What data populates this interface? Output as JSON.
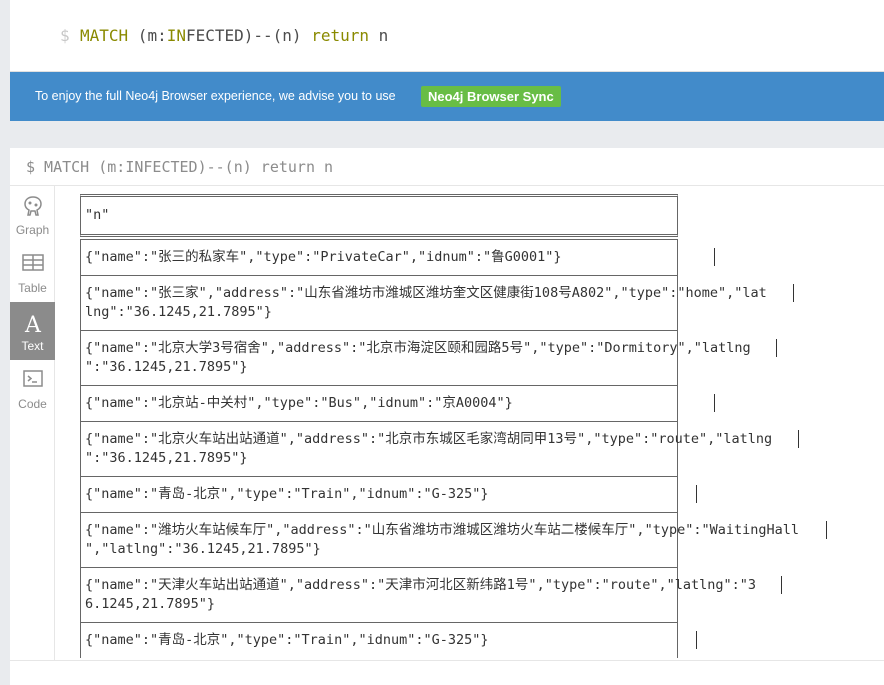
{
  "editor": {
    "prompt": "$",
    "query_parts": [
      "MATCH",
      " (m:",
      "IN",
      "FECTED)--(n) ",
      "return",
      " n"
    ]
  },
  "banner": {
    "message": "To enjoy the full Neo4j Browser experience, we advise you to use",
    "sync_label": "Neo4j Browser Sync",
    "color": "#428bca",
    "sync_color": "#68bd45"
  },
  "frame": {
    "query": "$ MATCH (m:INFECTED)--(n) return n"
  },
  "sidebar": {
    "tabs": [
      {
        "label": "Graph",
        "icon": "graph-icon",
        "active": false
      },
      {
        "label": "Table",
        "icon": "table-icon",
        "active": false
      },
      {
        "label": "Text",
        "icon": "text-icon",
        "active": true
      },
      {
        "label": "Code",
        "icon": "code-icon",
        "active": false
      }
    ]
  },
  "results": {
    "header": "\"n\"",
    "rows": [
      [
        "{\"name\":\"张三的私家车\",\"type\":\"PrivateCar\",\"idnum\":\"鲁G0001\"}"
      ],
      [
        "{\"name\":\"张三家\",\"address\":\"山东省潍坊市潍城区潍坊奎文区健康街108号A802\",\"type\":\"home\",\"lat",
        "lng\":\"36.1245,21.7895\"}"
      ],
      [
        "{\"name\":\"北京大学3号宿舍\",\"address\":\"北京市海淀区颐和园路5号\",\"type\":\"Dormitory\",\"latlng",
        "\":\"36.1245,21.7895\"}"
      ],
      [
        "{\"name\":\"北京站-中关村\",\"type\":\"Bus\",\"idnum\":\"京A0004\"}"
      ],
      [
        "{\"name\":\"北京火车站出站通道\",\"address\":\"北京市东城区毛家湾胡同甲13号\",\"type\":\"route\",\"latlng",
        "\":\"36.1245,21.7895\"}"
      ],
      [
        "{\"name\":\"青岛-北京\",\"type\":\"Train\",\"idnum\":\"G-325\"}"
      ],
      [
        "{\"name\":\"潍坊火车站候车厅\",\"address\":\"山东省潍坊市潍城区潍坊火车站二楼候车厅\",\"type\":\"WaitingHall",
        "\",\"latlng\":\"36.1245,21.7895\"}"
      ],
      [
        "{\"name\":\"天津火车站出站通道\",\"address\":\"天津市河北区新纬路1号\",\"type\":\"route\",\"latlng\":\"3",
        "6.1245,21.7895\"}"
      ],
      [
        "{\"name\":\"青岛-北京\",\"type\":\"Train\",\"idnum\":\"G-325\"}"
      ]
    ]
  }
}
